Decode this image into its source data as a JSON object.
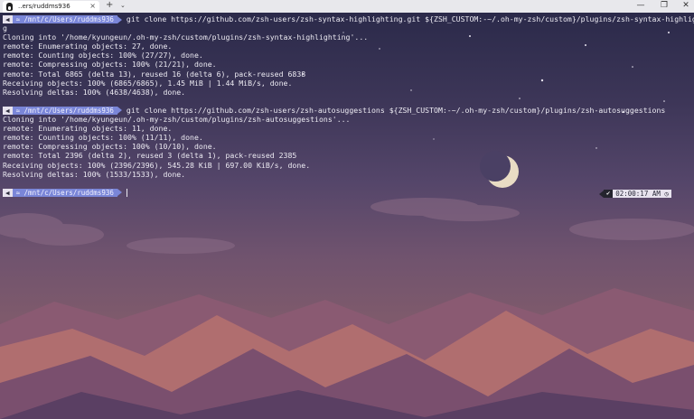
{
  "window": {
    "tab_title": "..ers/ruddms936",
    "tab_close": "×",
    "new_tab": "+",
    "tab_dropdown": "⌄",
    "minimize": "—",
    "maximize": "❐",
    "close": "✕"
  },
  "terminal": {
    "prompt": {
      "os_glyph": "◀",
      "path": "≈ /mnt/c/Users/ruddms936"
    },
    "block1": {
      "command": "git clone https://github.com/zsh-users/zsh-syntax-highlighting.git ${ZSH_CUSTOM:-~/.oh-my-zsh/custom}/plugins/zsh-syntax-highlightin",
      "wrap": "g",
      "output": [
        "Cloning into '/home/kyungeun/.oh-my-zsh/custom/plugins/zsh-syntax-highlighting'...",
        "remote: Enumerating objects: 27, done.",
        "remote: Counting objects: 100% (27/27), done.",
        "remote: Compressing objects: 100% (21/21), done.",
        "remote: Total 6865 (delta 13), reused 16 (delta 6), pack-reused 6838",
        "Receiving objects: 100% (6865/6865), 1.45 MiB | 1.44 MiB/s, done.",
        "Resolving deltas: 100% (4638/4638), done."
      ]
    },
    "block2": {
      "command": "git clone https://github.com/zsh-users/zsh-autosuggestions ${ZSH_CUSTOM:-~/.oh-my-zsh/custom}/plugins/zsh-autosuggestions",
      "output": [
        "Cloning into '/home/kyungeun/.oh-my-zsh/custom/plugins/zsh-autosuggestions'...",
        "remote: Enumerating objects: 11, done.",
        "remote: Counting objects: 100% (11/11), done.",
        "remote: Compressing objects: 100% (10/10), done.",
        "remote: Total 2396 (delta 2), reused 3 (delta 1), pack-reused 2385",
        "Receiving objects: 100% (2396/2396), 545.28 KiB | 697.00 KiB/s, done.",
        "Resolving deltas: 100% (1533/1533), done."
      ]
    },
    "right_prompt": {
      "status": "✔",
      "time": "02:00:17 AM",
      "clock_glyph": "◷"
    }
  },
  "colors": {
    "prompt_path_bg": "#7a86d8",
    "prompt_os_bg": "#e7e3ee",
    "terminal_text": "#eceaf2"
  }
}
